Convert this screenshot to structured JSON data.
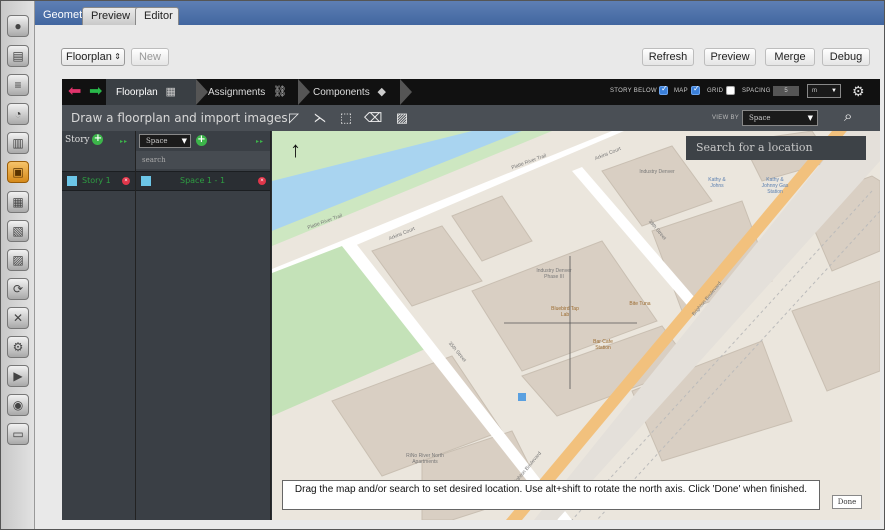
{
  "tabs": {
    "geometry": "Geometry",
    "preview": "Preview",
    "editor": "Editor"
  },
  "toolbar": {
    "floorplan_select": "Floorplan",
    "new_label": "New",
    "refresh_label": "Refresh",
    "preview_label": "Preview",
    "merge_label": "Merge",
    "debug_label": "Debug"
  },
  "nav": {
    "modes": [
      "Floorplan",
      "Assignments",
      "Components"
    ],
    "story_below": "STORY BELOW",
    "map": "MAP",
    "grid": "GRID",
    "spacing": "SPACING",
    "spacing_value": "5",
    "unit": "m",
    "checks": {
      "story_below": true,
      "map": true,
      "grid": false
    }
  },
  "tools": {
    "title": "Draw a floorplan and import images",
    "view_by_label": "VIEW BY",
    "view_by_value": "Space"
  },
  "stories": {
    "header": "Story",
    "items": [
      {
        "name": "Story 1",
        "color": "#6cc6e8"
      }
    ]
  },
  "spaces": {
    "select": "Space",
    "search": "search",
    "items": [
      {
        "name": "Space 1 - 1",
        "color": "#6cc6e8"
      }
    ]
  },
  "map": {
    "search_placeholder": "Search for a location",
    "labels": {
      "industry_denver": "Industry Denver",
      "industry_denver_phase": "Industry Denver Phase III",
      "platte_river_trail": "Platte River Trail",
      "platte_river_trail_2": "Platte River Trail",
      "arkins_court": "Arkins Court",
      "arkins_court_2": "Arkins Court",
      "street_38th": "38th Street",
      "street_35th": "35th Street",
      "brighton_blvd": "Brighton Boulevard",
      "brighton_blvd_2": "Brighton Boulevard",
      "kathy_johns": "Kathy & Johns",
      "kathy_johns_gas": "Kathy & Johnny Gas Station",
      "rino_river_north": "RiNo River North Apartments",
      "bite_tuna": "Bite Tuna",
      "bar_cafe": "Bar Cafe Station",
      "bluebird_tap": "Bluebird Tap Lab"
    }
  },
  "hint": "Drag the map and/or search to set desired location. Use alt+shift to rotate the north axis. Click 'Done' when finished.",
  "done_label": "Done"
}
